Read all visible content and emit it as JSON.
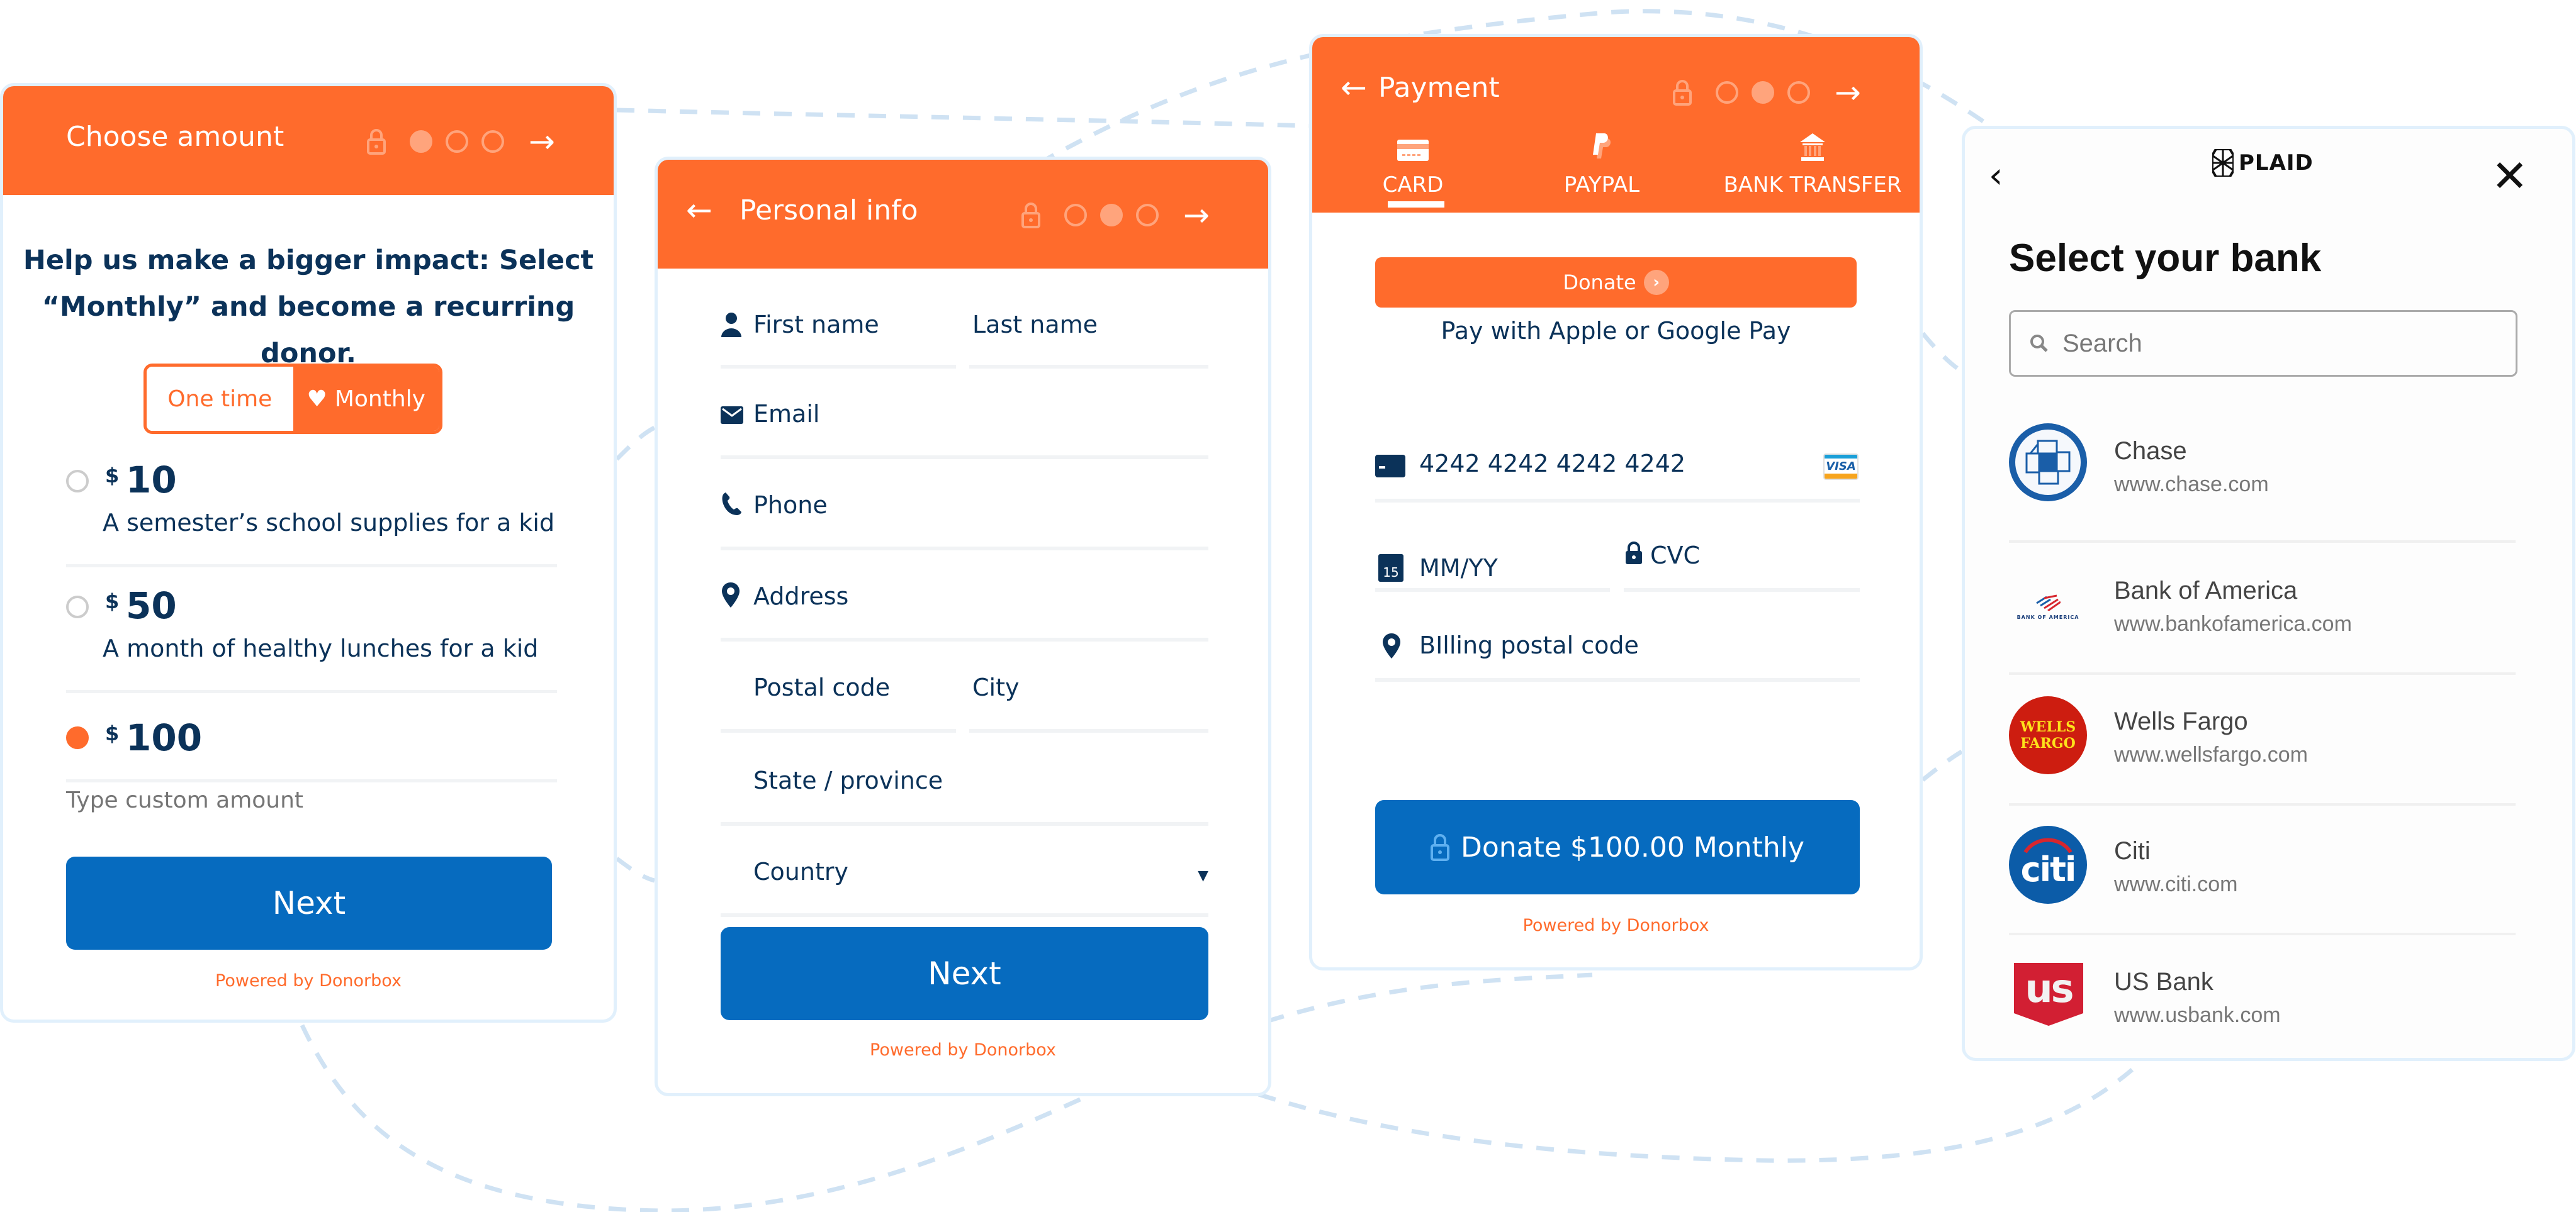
{
  "colors": {
    "brand_orange": "#ff6b2c",
    "primary_blue": "#066bbf",
    "navy_text": "#0b3259",
    "panel_border": "#e1f0fc"
  },
  "choose_amount": {
    "header_title": "Choose amount",
    "current_step": 1,
    "total_steps": 3,
    "impact_message": "Help us make a bigger impact: Select “Monthly” and become a recurring donor.",
    "frequency_options": [
      {
        "label": "One time",
        "selected": false
      },
      {
        "label": "Monthly",
        "selected": true,
        "icon": "heart-icon"
      }
    ],
    "currency_symbol": "$",
    "amounts": [
      {
        "value": "10",
        "description": "A semester’s school supplies for a kid",
        "selected": false
      },
      {
        "value": "50",
        "description": "A month of healthy lunches for a kid",
        "selected": false
      },
      {
        "value": "100",
        "description": "",
        "selected": true
      }
    ],
    "custom_amount_placeholder": "Type custom amount",
    "next_label": "Next",
    "powered_by": "Powered by Donorbox"
  },
  "personal_info": {
    "header_title": "Personal info",
    "current_step": 2,
    "total_steps": 3,
    "fields": {
      "first_name": "First name",
      "last_name": "Last name",
      "email": "Email",
      "phone": "Phone",
      "address": "Address",
      "postal_code": "Postal code",
      "city": "City",
      "state": "State / province",
      "country": "Country"
    },
    "next_label": "Next",
    "powered_by": "Powered by Donorbox"
  },
  "payment": {
    "header_title": "Payment",
    "current_step": 2,
    "total_steps": 3,
    "tabs": [
      {
        "label": "CARD",
        "icon": "credit-card-icon",
        "active": true
      },
      {
        "label": "PAYPAL",
        "icon": "paypal-icon",
        "active": false
      },
      {
        "label": "BANK TRANSFER",
        "icon": "bank-icon",
        "active": false
      }
    ],
    "quick_donate_label": "Donate",
    "wallet_text": "Pay with Apple or Google Pay",
    "card_number": "4242 4242 4242 4242",
    "card_brand": "VISA",
    "expiry_placeholder": "MM/YY",
    "calendar_day": "15",
    "cvc_placeholder": "CVC",
    "billing_postal_placeholder": "BIlling postal code",
    "submit_label": "Donate $100.00 Monthly",
    "powered_by": "Powered by Donorbox"
  },
  "plaid": {
    "brand": "PLAID",
    "title": "Select your bank",
    "search_placeholder": "Search",
    "banks": [
      {
        "name": "Chase",
        "url": "www.chase.com",
        "logo": "chase-logo-icon"
      },
      {
        "name": "Bank of America",
        "url": "www.bankofamerica.com",
        "logo": "bank-of-america-logo-icon",
        "logo_text": "BANK OF AMERICA"
      },
      {
        "name": "Wells Fargo",
        "url": "www.wellsfargo.com",
        "logo": "wells-fargo-logo-icon",
        "logo_text_1": "WELLS",
        "logo_text_2": "FARGO"
      },
      {
        "name": "Citi",
        "url": "www.citi.com",
        "logo": "citi-logo-icon",
        "logo_text": "citi"
      },
      {
        "name": "US Bank",
        "url": "www.usbank.com",
        "logo": "us-bank-logo-icon",
        "logo_text": "us"
      }
    ]
  }
}
